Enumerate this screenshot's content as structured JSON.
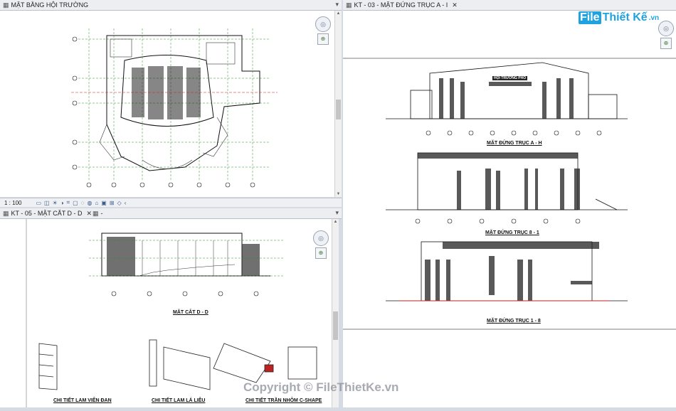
{
  "views": {
    "floor_plan": {
      "tab_label": "MẶT BẰNG HỘI TRƯỜNG",
      "scale": "1 : 100"
    },
    "section": {
      "tab_label": "KT - 05 - MẶT CẮT D - D",
      "second_tab_label": "-"
    },
    "elevation": {
      "tab_label": "KT - 03 - MẶT ĐỨNG TRỤC A - I"
    }
  },
  "section_sheet": {
    "section_title": "MẶT CẮT D - D",
    "detail_1": "CHI TIẾT LAM VIÊN ĐAN",
    "detail_2": "CHI TIẾT LAM LÁ LIỄU",
    "detail_3": "CHI TIẾT TRẦN NHÔM C-SHAPE"
  },
  "elevation_sheet": {
    "building_sign": "HỘI TRƯỜNG PHỐ",
    "elevation_1": "MẶT ĐỨNG TRỤC A - H",
    "elevation_2": "MẶT ĐỨNG TRỤC 8 - 1",
    "elevation_3": "MẶT ĐỨNG TRỤC 1 - 8"
  },
  "branding": {
    "logo_f": "File",
    "logo_rest": "Thiết Kế",
    "logo_tld": ".vn",
    "watermark": "Copyright © FileThietKe.vn"
  },
  "colors": {
    "accent": "#1fa3e0",
    "cad_line": "#1a1a1a",
    "grid_green": "#2e8b2e"
  }
}
